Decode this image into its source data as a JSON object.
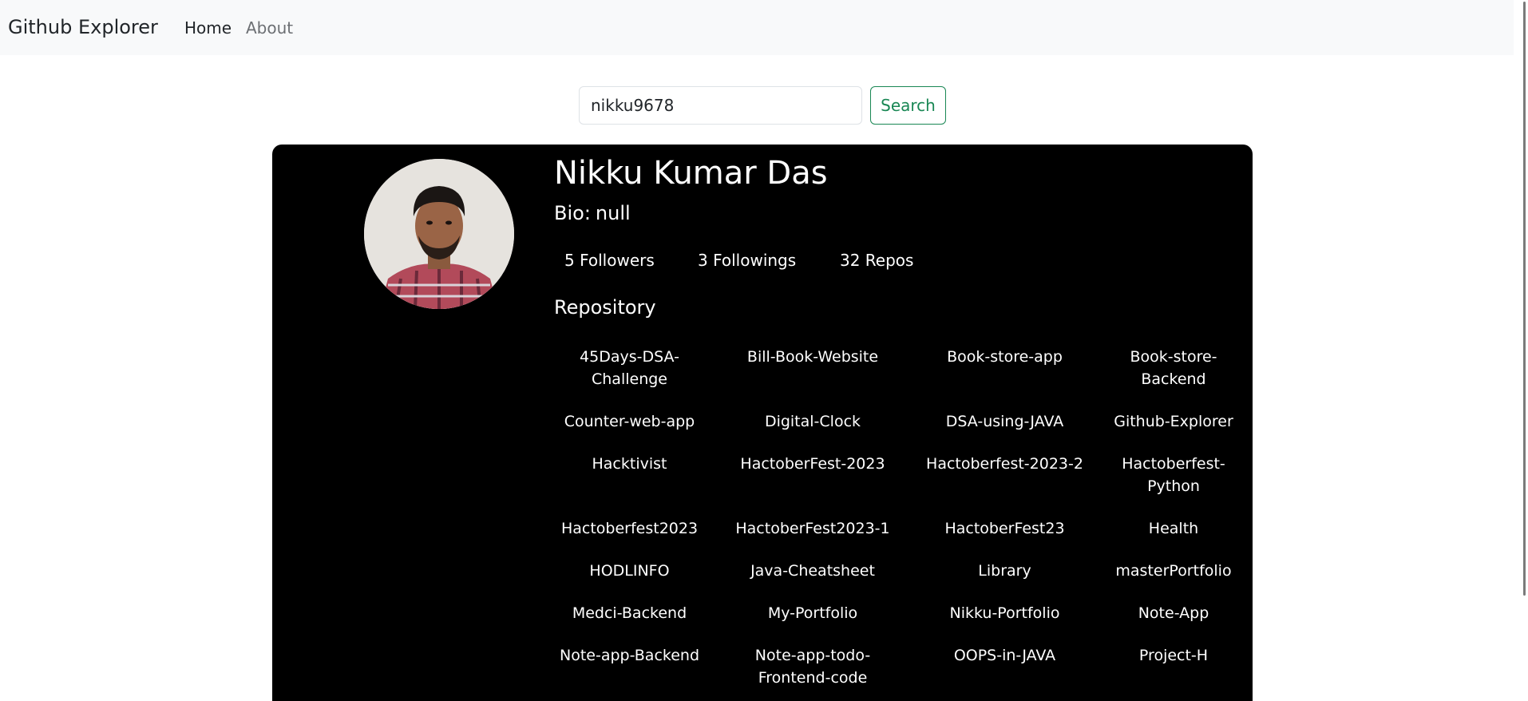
{
  "nav": {
    "brand": "Github Explorer",
    "links": [
      {
        "label": "Home"
      },
      {
        "label": "About"
      }
    ]
  },
  "search": {
    "value": "nikku9678",
    "placeholder": "",
    "button_label": "Search"
  },
  "profile": {
    "name": "Nikku Kumar Das",
    "bio_label": "Bio:",
    "bio_value": "null",
    "followers": "5 Followers",
    "following": "3 Followings",
    "repos": "32 Repos",
    "repo_heading": "Repository",
    "repositories": [
      [
        "45Days-DSA-Challenge",
        "Bill-Book-Website",
        "Book-store-app",
        "Book-store-Backend"
      ],
      [
        "Counter-web-app",
        "Digital-Clock",
        "DSA-using-JAVA",
        "Github-Explorer"
      ],
      [
        "Hacktivist",
        "HactoberFest-2023",
        "Hactoberfest-2023-2",
        "Hactoberfest-Python"
      ],
      [
        "Hactoberfest2023",
        "HactoberFest2023-1",
        "HactoberFest23",
        "Health"
      ],
      [
        "HODLINFO",
        "Java-Cheatsheet",
        "Library",
        "masterPortfolio"
      ],
      [
        "Medci-Backend",
        "My-Portfolio",
        "Nikku-Portfolio",
        "Note-App"
      ],
      [
        "Note-app-Backend",
        "Note-app-todo-Frontend-code",
        "OOPS-in-JAVA",
        "Project-H"
      ]
    ]
  },
  "colors": {
    "navbar_bg": "#f8f9fa",
    "card_bg": "#000000",
    "search_accent": "#198754"
  }
}
